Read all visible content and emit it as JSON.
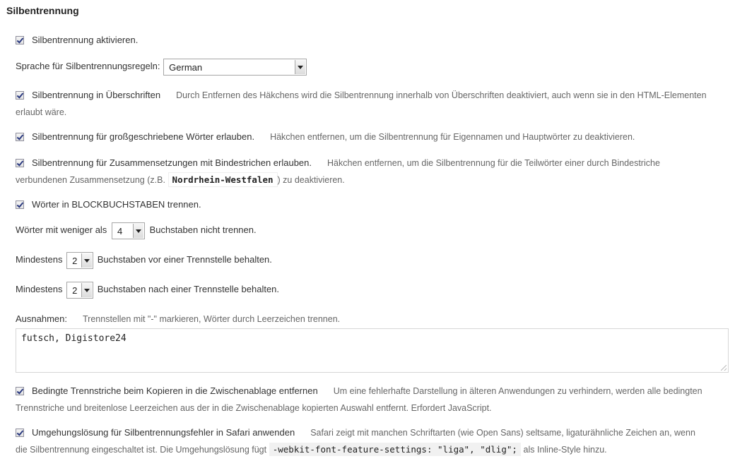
{
  "section_title": "Silbentrennung",
  "enable": {
    "label": "Silbentrennung aktivieren."
  },
  "language": {
    "label": "Sprache für Silbentrennungsregeln:",
    "value": "German"
  },
  "headings": {
    "label": "Silbentrennung in Überschriften",
    "desc": "Durch Entfernen des Häkchens wird die Silbentrennung innerhalb von Überschriften deaktiviert, auch wenn sie in den HTML-Elementen erlaubt wäre."
  },
  "caps": {
    "label": "Silbentrennung für großgeschriebene Wörter erlauben.",
    "desc": "Häkchen entfernen, um die Silbentrennung für Eigennamen und Hauptwörter zu deaktivieren."
  },
  "compounds": {
    "label": "Silbentrennung für Zusammensetzungen mit Bindestrichen erlauben.",
    "desc_before": "Häkchen entfernen, um die Silbentrennung für die Teilwörter einer durch Bindestriche verbundenen Zusammensetzung (z.B.",
    "example": "Nordrhein-Westfalen",
    "desc_after": ") zu deaktivieren."
  },
  "allcaps": {
    "label": "Wörter in BLOCKBUCHSTABEN trennen."
  },
  "min_length": {
    "before": "Wörter mit weniger als",
    "value": "4",
    "after": "Buchstaben nicht trennen."
  },
  "min_before": {
    "before": "Mindestens",
    "value": "2",
    "after": "Buchstaben vor einer Trennstelle behalten."
  },
  "min_after": {
    "before": "Mindestens",
    "value": "2",
    "after": "Buchstaben nach einer Trennstelle behalten."
  },
  "exceptions": {
    "label": "Ausnahmen:",
    "desc": "Trennstellen mit \"-\" markieren, Wörter durch Leerzeichen trennen.",
    "value": "futsch, Digistore24"
  },
  "clipboard": {
    "label": "Bedingte Trennstriche beim Kopieren in die Zwischenablage entfernen",
    "desc": "Um eine fehlerhafte Darstellung in älteren Anwendungen zu verhindern, werden alle bedingten Trennstriche und breitenlose Leerzeichen aus der in die Zwischenablage kopierten Auswahl entfernt. Erfordert JavaScript."
  },
  "safari": {
    "label": "Umgehungslösung für Silbentrennungsfehler in Safari anwenden",
    "desc_before": "Safari zeigt mit manchen Schriftarten (wie Open Sans) seltsame, ligaturähnliche Zeichen an, wenn die Silbentrennung eingeschaltet ist. Die Umgehungslösung fügt",
    "code": "-webkit-font-feature-settings: \"liga\", \"dlig\";",
    "desc_after": "als Inline-Style hinzu."
  }
}
